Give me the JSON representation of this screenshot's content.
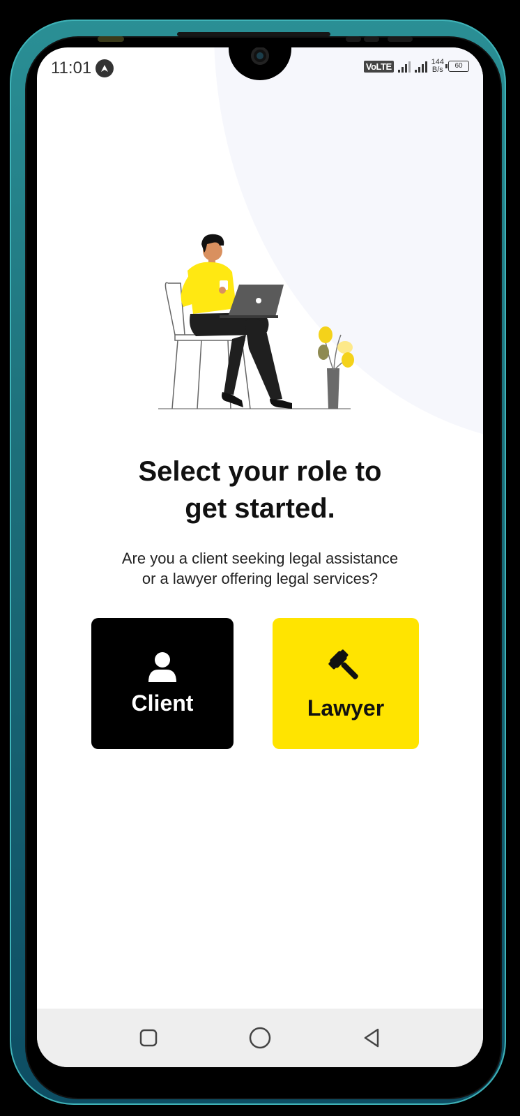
{
  "status_bar": {
    "time": "11:01",
    "network_type": "VoLTE",
    "net_speed_value": "144",
    "net_speed_unit": "B/s",
    "battery": "60"
  },
  "onboarding": {
    "heading_line1": "Select your role to",
    "heading_line2": "get started.",
    "subtext_line1": "Are you a client seeking legal assistance",
    "subtext_line2": "or a lawyer offering legal services?"
  },
  "roles": [
    {
      "label": "Client",
      "icon": "user-icon",
      "color": "#000000"
    },
    {
      "label": "Lawyer",
      "icon": "gavel-icon",
      "color": "#FFE400"
    }
  ],
  "nav_bar": {
    "items": [
      "recent-apps",
      "home",
      "back"
    ]
  },
  "colors": {
    "accent": "#FFE400",
    "dark": "#000000",
    "background": "#FFFFFF",
    "navbar": "#EEEEEE"
  }
}
